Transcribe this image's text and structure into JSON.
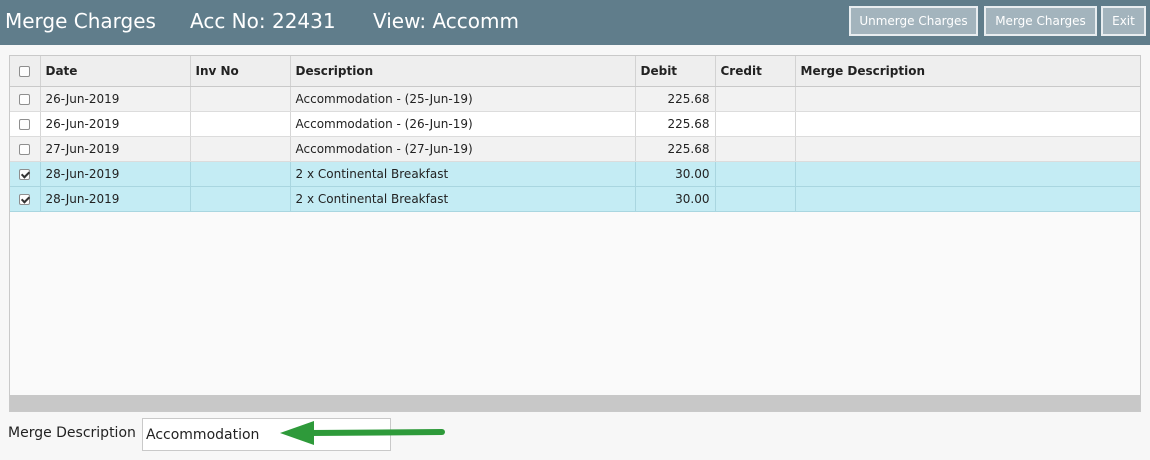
{
  "header": {
    "title": "Merge Charges",
    "account": "Acc No: 22431",
    "view": "View: Accomm",
    "buttons": {
      "unmerge": "Unmerge Charges",
      "merge": "Merge Charges",
      "exit": "Exit"
    }
  },
  "table": {
    "columns": [
      "Date",
      "Inv No",
      "Description",
      "Debit",
      "Credit",
      "Merge Description"
    ],
    "rows": [
      {
        "checked": false,
        "date": "26-Jun-2019",
        "inv_no": "",
        "description": "Accommodation - (25-Jun-19)",
        "debit": "225.68",
        "credit": "",
        "merge_description": ""
      },
      {
        "checked": false,
        "date": "26-Jun-2019",
        "inv_no": "",
        "description": "Accommodation - (26-Jun-19)",
        "debit": "225.68",
        "credit": "",
        "merge_description": ""
      },
      {
        "checked": false,
        "date": "27-Jun-2019",
        "inv_no": "",
        "description": "Accommodation - (27-Jun-19)",
        "debit": "225.68",
        "credit": "",
        "merge_description": ""
      },
      {
        "checked": true,
        "date": "28-Jun-2019",
        "inv_no": "",
        "description": "2 x Continental Breakfast",
        "debit": "30.00",
        "credit": "",
        "merge_description": ""
      },
      {
        "checked": true,
        "date": "28-Jun-2019",
        "inv_no": "",
        "description": "2 x Continental Breakfast",
        "debit": "30.00",
        "credit": "",
        "merge_description": ""
      }
    ]
  },
  "footer": {
    "merge_label": "Merge Description",
    "merge_value": "Accommodation"
  },
  "colors": {
    "titlebar": "#607d8b",
    "selected_row": "#c4ecf4",
    "annotation_arrow": "#2e9a3a"
  },
  "icons": {
    "annotation": "arrow-left-icon"
  }
}
